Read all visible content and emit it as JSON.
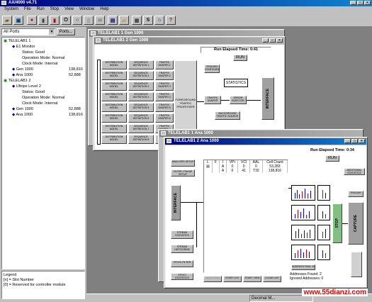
{
  "app": {
    "title": "AX/4000 v4.71"
  },
  "menu": [
    "System",
    "File",
    "Run",
    "Stop",
    "View",
    "Window",
    "Help"
  ],
  "toolbar_icons": [
    "open-folder-icon",
    "save-icon",
    "record-icon",
    "lock-icon",
    "statistics-icon",
    "exit-icon",
    "stop-icon",
    "document-icon",
    "envelope-icon",
    "save-disk-icon",
    "open-folder-icon",
    "print-icon",
    "s-icon",
    "network-icon",
    "question-icon"
  ],
  "ports": {
    "selected": "All Ports",
    "button": "Ports..."
  },
  "tree": [
    {
      "label": "TELELAB1 1",
      "value": "",
      "indent": 0
    },
    {
      "label": "E1 Monitor",
      "value": "",
      "indent": 1
    },
    {
      "label": "Status: Good",
      "value": "",
      "indent": 2
    },
    {
      "label": "Operation Mode: Normal",
      "value": "",
      "indent": 2
    },
    {
      "label": "Clock Mode: Internal",
      "value": "",
      "indent": 2
    },
    {
      "label": "Gen 1000",
      "value": "138,816",
      "indent": 1
    },
    {
      "label": "Ana 1000",
      "value": "52,888",
      "indent": 1
    },
    {
      "label": "TELELAB1 2",
      "value": "",
      "indent": 0
    },
    {
      "label": "Ultripe Level 2",
      "value": "",
      "indent": 1
    },
    {
      "label": "Status: Good",
      "value": "",
      "indent": 2
    },
    {
      "label": "Operation Mode: Normal",
      "value": "",
      "indent": 2
    },
    {
      "label": "Clock Mode: Internal",
      "value": "",
      "indent": 2
    },
    {
      "label": "Gen 1000",
      "value": "52,888",
      "indent": 1
    },
    {
      "label": "Ana 1000",
      "value": "138,816",
      "indent": 1
    }
  ],
  "legend": {
    "title": "Legend",
    "line1": "[n] = Slot Number",
    "line2": "[0] = Reserved for controller module"
  },
  "win_back": {
    "title": "TELELAB1 1 Gen 1000"
  },
  "win_gen": {
    "title": "TELELAB1 2 Gen 1000",
    "elapsed": "Run Elapsed Time: 0:41",
    "run": "RUN",
    "rows": [
      {
        "a": "DISTRIBUTION MODEL",
        "b": "SEQUENCE DEFINITION 1",
        "c": "TRAFFIC SHAPER 1"
      },
      {
        "a": "DISTRIBUTION MODEL",
        "b": "SEQUENCE DEFINITION 2",
        "c": "TRAFFIC SHAPER 2"
      },
      {
        "a": "DISTRIBUTION MODEL",
        "b": "SEQUENCE DEFINITION 3",
        "c": "TRAFFIC SHAPER 3"
      },
      {
        "a": "DISTRIBUTION MODEL",
        "b": "SEQUENCE DEFINITION 4",
        "c": "TRAFFIC SHAPER 4"
      },
      {
        "a": "DISTRIBUTION MODEL",
        "b": "SEQUENCE DEFINITION 5",
        "c": "TRAFFIC SHAPER 5"
      },
      {
        "a": "DISTRIBUTION MODEL",
        "b": "SEQUENCE DEFINITION 6",
        "c": "TRAFFIC SHAPER 6"
      },
      {
        "a": "DISTRIBUTION MODEL",
        "b": "SEQUENCE DEFINITION 7",
        "c": "TRAFFIC SHAPER 7"
      },
      {
        "a": "DISTRIBUTION MODEL",
        "b": "SEQUENCE DEFINITION 8",
        "c": "TRAFFIC SHAPER 8"
      }
    ],
    "prioritizer": "FOREGROUND TRAFFIC PRIORITIZER",
    "trigger": "TRIGGER CONFIGURATION",
    "statistics": "STATISTICS",
    "traffic_shaper": "TRAFFIC SHAPER",
    "error_injector": "ERROR INJECTOR",
    "background": "BACKGROUND TRAFFIC SOURCE",
    "interface": "INTERFACE"
  },
  "win_ana2": {
    "title": "TELELAB1 1 Ana 1000"
  },
  "win_ana": {
    "title": "TELELAB1 2 Ana 1000",
    "elapsed": "Run Elapsed Time: 0:34",
    "run": "RUN",
    "analyzer_setup": "ANALYZER SETUP",
    "filter_setup": "FILTER / PHASE SETUP",
    "interface": "INTERFACE",
    "stream_statistics": "STREAM STATISTICS",
    "stream_histogram": "STREAM HISTOGRAM",
    "vp_filter": "VP/VCI FILTER",
    "vp_stats": "VP/VCI STATISTICS",
    "table_headers": [
      "L",
      "F",
      "I",
      "VPI",
      "VCI",
      "AAL",
      "Cell Count"
    ],
    "table_rows": [
      [
        "",
        "",
        "A",
        "0",
        "0",
        "0",
        "53,283"
      ],
      [
        "",
        "",
        "A",
        "0",
        "41",
        "T32",
        "138,816"
      ]
    ],
    "buttons": [
      "AUTO FIND",
      "START LIST",
      "START VIEW",
      "CLEAR LIST"
    ],
    "additional_stats": "ADDITIONAL STATISTICS",
    "trigger": "TRIGGER",
    "capture": "CAPTURE",
    "stop_label": "STOP",
    "address_find": "ADDRESS FIND: 15",
    "addresses_found": "Addresses Found: 2",
    "ignored_addresses": "Ignored Addresses: 0"
  },
  "statusbar": {
    "mode": "Decimal M..."
  },
  "watermark": "www.55dianzi.com"
}
